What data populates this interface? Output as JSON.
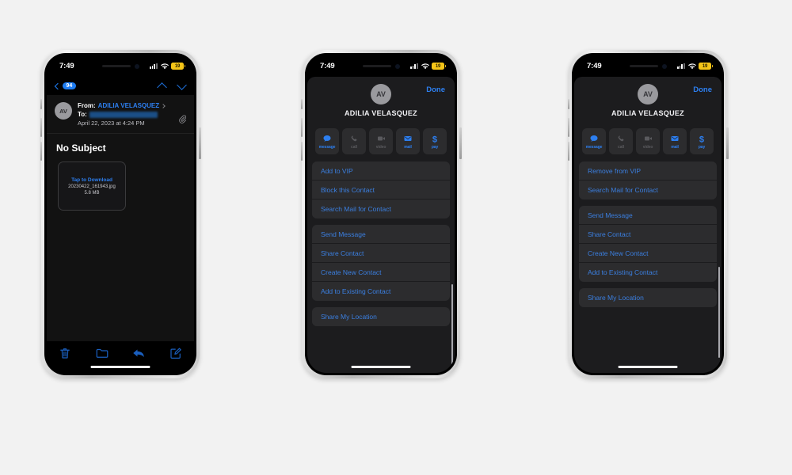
{
  "meta": {
    "background": "#f2f2f2",
    "accent_blue": "#2d7ff0",
    "battery_color": "#f5c518",
    "sheet_bg": "#1c1c1e"
  },
  "status_bar": {
    "time": "7:49",
    "battery_level": "19",
    "signal_icon": "cellular-signal-icon",
    "wifi_icon": "wifi-icon",
    "battery_icon": "battery-low-power-icon"
  },
  "phone1": {
    "name": "mail-message-screen",
    "nav": {
      "back_icon": "chevron-left-icon",
      "unread_badge": "94",
      "prev_icon": "chevron-up-icon",
      "next_icon": "chevron-down-icon"
    },
    "message": {
      "avatar_initials": "AV",
      "from_label": "From:",
      "from_name": "ADILIA VELASQUEZ",
      "to_label": "To:",
      "to_value_redacted": "",
      "date": "April 22, 2023 at 4:24 PM",
      "detail_chevron_icon": "chevron-right-icon",
      "attachment_clip_icon": "paperclip-icon",
      "subject": "No Subject"
    },
    "attachment": {
      "action": "Tap to Download",
      "filename": "20230422_161943.jpg",
      "size": "5.8 MB"
    },
    "toolbar": [
      {
        "label": "Delete",
        "icon": "trash-icon"
      },
      {
        "label": "Move",
        "icon": "folder-icon"
      },
      {
        "label": "Reply",
        "icon": "reply-arrow-icon"
      },
      {
        "label": "Compose",
        "icon": "compose-pencil-icon"
      }
    ]
  },
  "contact_sheet": {
    "avatar_initials": "AV",
    "name": "ADILIA VELASQUEZ",
    "done_label": "Done",
    "actions": [
      {
        "label": "message",
        "icon": "message-bubble-icon",
        "enabled": true
      },
      {
        "label": "call",
        "icon": "phone-handset-icon",
        "enabled": false
      },
      {
        "label": "video",
        "icon": "video-camera-icon",
        "enabled": false
      },
      {
        "label": "mail",
        "icon": "envelope-icon",
        "enabled": true
      },
      {
        "label": "pay",
        "icon": "dollar-sign-icon",
        "enabled": true
      }
    ]
  },
  "phone2": {
    "name": "contact-sheet-not-vip",
    "groups": [
      {
        "items": [
          "Add to VIP",
          "Block this Contact",
          "Search Mail for Contact"
        ]
      },
      {
        "items": [
          "Send Message",
          "Share Contact",
          "Create New Contact",
          "Add to Existing Contact"
        ]
      },
      {
        "items": [
          "Share My Location"
        ]
      }
    ]
  },
  "phone3": {
    "name": "contact-sheet-is-vip",
    "groups": [
      {
        "items": [
          "Remove from VIP",
          "Search Mail for Contact"
        ]
      },
      {
        "items": [
          "Send Message",
          "Share Contact",
          "Create New Contact",
          "Add to Existing Contact"
        ]
      },
      {
        "items": [
          "Share My Location"
        ]
      }
    ]
  }
}
